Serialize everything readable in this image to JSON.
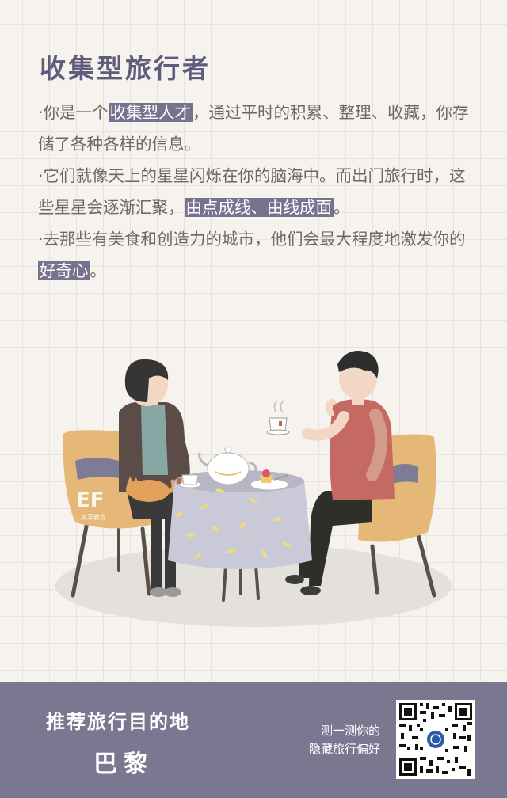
{
  "title": "收集型旅行者",
  "paragraphs": [
    {
      "pre": "·你是一个",
      "hl": "收集型人才",
      "post": "，通过平时的积累、整理、收藏，你存储了各种各样的信息。"
    },
    {
      "pre": "·它们就像天上的星星闪烁在你的脑海中。而出门旅行时，这些星星会逐渐汇聚，",
      "hl": "由点成线、由线成面",
      "post": "。"
    },
    {
      "pre": "·去那些有美食和创造力的城市，他们会最大程度地激发你的",
      "hl": "好奇心",
      "post": "。"
    }
  ],
  "illustration": {
    "logo_text": "EF",
    "logo_sub": "英孚教育"
  },
  "footer": {
    "rec_label": "推荐旅行目的地",
    "city": "巴黎",
    "scan_line1": "测一测你的",
    "scan_line2": "隐藏旅行偏好"
  },
  "colors": {
    "accent": "#77738f",
    "footer_bg": "#7a7791",
    "title": "#5f5b7b",
    "text": "#6b6866",
    "chair": "#e6b877"
  }
}
